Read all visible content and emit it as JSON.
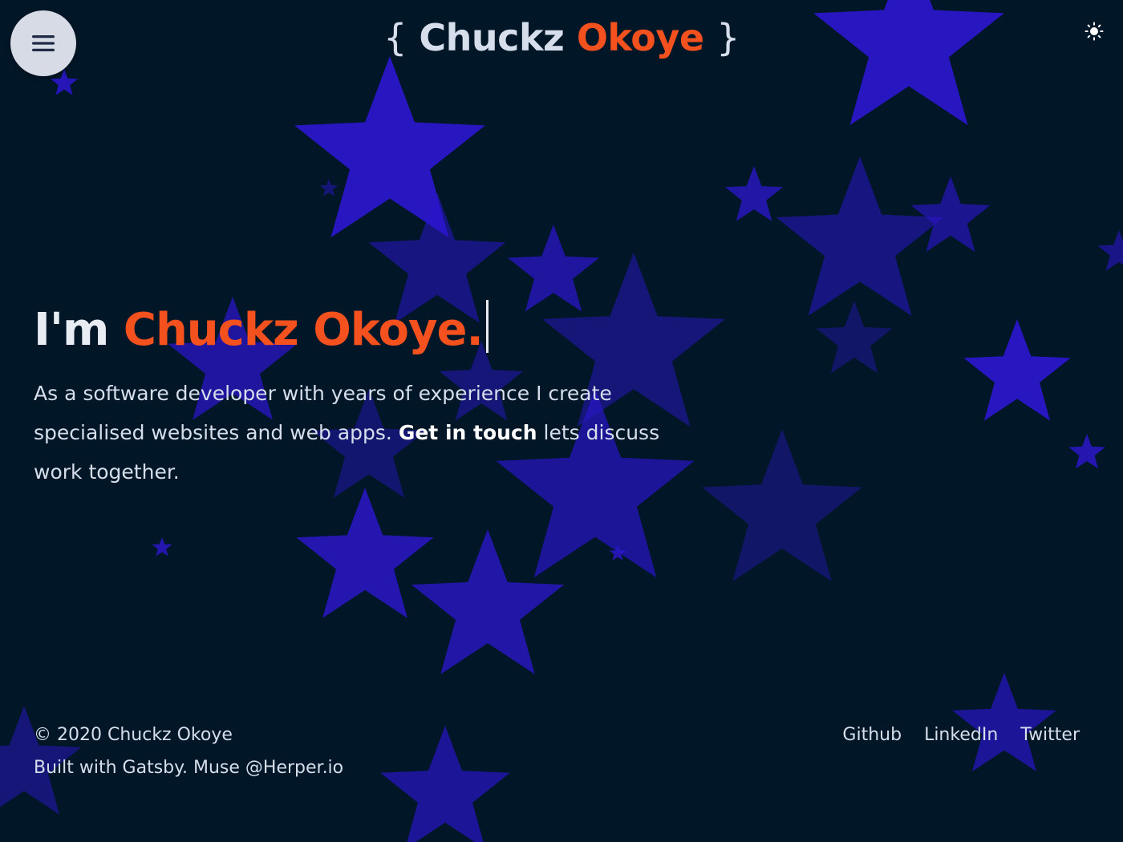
{
  "header": {
    "menu_icon": "hamburger-menu-icon",
    "title_open_brace": "{",
    "title_first": "Chuckz",
    "title_last": "Okoye",
    "title_close_brace": "}",
    "theme_icon": "sun-icon"
  },
  "hero": {
    "heading_prefix": "I'm",
    "heading_name": "Chuckz Okoye.",
    "text_before": "As a software developer with years of experience I create specialised websites and web apps.",
    "cta_label": "Get in touch",
    "text_after": "lets discuss work together."
  },
  "footer": {
    "copyright": "© 2020 Chuckz Okoye",
    "credits": "Built with Gatsby. Muse @Herper.io",
    "links": [
      "Github",
      "LinkedIn",
      "Twitter"
    ]
  },
  "colors": {
    "background": "#011627",
    "accent": "#f4511e",
    "text": "#d6deeb",
    "star": "#2a16c8"
  }
}
